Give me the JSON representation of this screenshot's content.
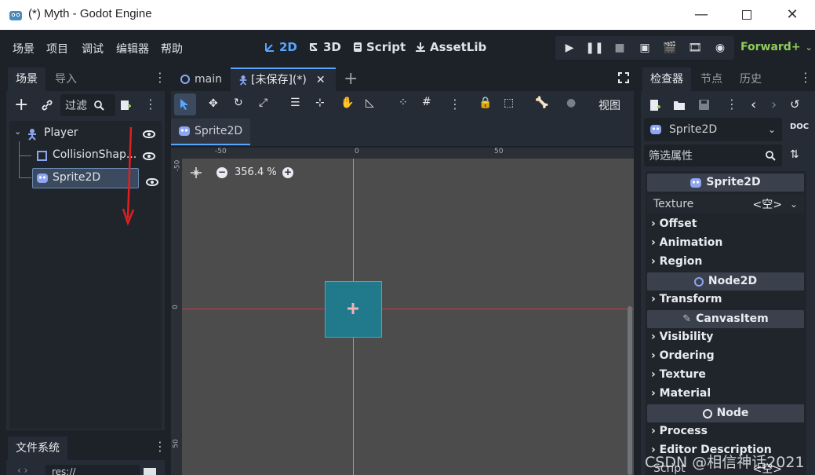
{
  "window": {
    "title": "(*) Myth - Godot Engine"
  },
  "menu": [
    "场景",
    "项目",
    "调试",
    "编辑器",
    "帮助"
  ],
  "modes": [
    {
      "label": "2D",
      "active": true
    },
    {
      "label": "3D",
      "active": false
    },
    {
      "label": "Script",
      "active": false
    },
    {
      "label": "AssetLib",
      "active": false
    }
  ],
  "renderer": "Forward+",
  "left_dock": {
    "tabs": [
      "场景",
      "导入"
    ],
    "filter_placeholder": "过滤",
    "tree": [
      {
        "label": "Player",
        "icon": "character-body-icon"
      },
      {
        "label": "CollisionShap...",
        "icon": "collision-shape-icon"
      },
      {
        "label": "Sprite2D",
        "icon": "sprite2d-icon",
        "selected": true
      }
    ]
  },
  "filesystem": {
    "tab": "文件系统",
    "path": "res://"
  },
  "scene_tabs": [
    {
      "label": "main",
      "icon": "node2d-icon"
    },
    {
      "label": "[未保存](*)",
      "icon": "character-body-icon",
      "active": true
    }
  ],
  "toolbar": {
    "view_label": "视图"
  },
  "selected_node_tab": "Sprite2D",
  "viewport": {
    "zoom": "356.4 %",
    "ruler_h": [
      "-50",
      "0",
      "50"
    ],
    "ruler_v": [
      "-50",
      "0",
      "50"
    ]
  },
  "inspector": {
    "tabs": [
      "检查器",
      "节点",
      "历史"
    ],
    "node_select": "Sprite2D",
    "filter_placeholder": "筛选属性",
    "sections": [
      {
        "type": "header",
        "label": "Sprite2D",
        "icon": "sprite2d-icon"
      },
      {
        "type": "prop",
        "label": "Texture",
        "value": "<空>"
      },
      {
        "type": "group",
        "label": "Offset"
      },
      {
        "type": "group",
        "label": "Animation"
      },
      {
        "type": "group",
        "label": "Region"
      },
      {
        "type": "header",
        "label": "Node2D",
        "icon": "node2d-icon"
      },
      {
        "type": "group",
        "label": "Transform"
      },
      {
        "type": "header",
        "label": "CanvasItem",
        "icon": "canvasitem-icon"
      },
      {
        "type": "group",
        "label": "Visibility"
      },
      {
        "type": "group",
        "label": "Ordering"
      },
      {
        "type": "group",
        "label": "Texture"
      },
      {
        "type": "group",
        "label": "Material"
      },
      {
        "type": "header",
        "label": "Node",
        "icon": "node-icon"
      },
      {
        "type": "group",
        "label": "Process"
      },
      {
        "type": "group",
        "label": "Editor Description"
      },
      {
        "type": "prop",
        "label": "Script",
        "value": "<空>"
      }
    ]
  },
  "watermark": "CSDN @相信神话2021",
  "colors": {
    "accent": "#57a6ff",
    "renderer": "#8fce58",
    "selection": "#3b4a5e",
    "sprite_fill": "#217a8b"
  }
}
